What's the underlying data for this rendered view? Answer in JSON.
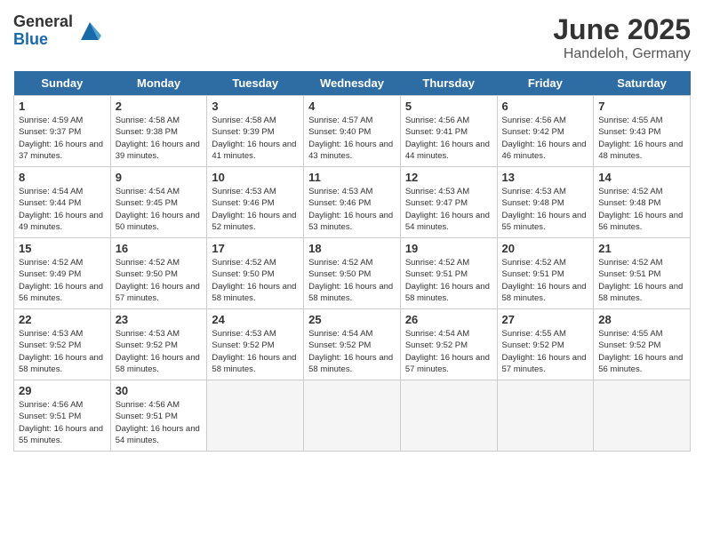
{
  "header": {
    "logo_general": "General",
    "logo_blue": "Blue",
    "title": "June 2025",
    "subtitle": "Handeloh, Germany"
  },
  "weekdays": [
    "Sunday",
    "Monday",
    "Tuesday",
    "Wednesday",
    "Thursday",
    "Friday",
    "Saturday"
  ],
  "weeks": [
    [
      {
        "day": "1",
        "sunrise": "4:59 AM",
        "sunset": "9:37 PM",
        "daylight": "16 hours and 37 minutes."
      },
      {
        "day": "2",
        "sunrise": "4:58 AM",
        "sunset": "9:38 PM",
        "daylight": "16 hours and 39 minutes."
      },
      {
        "day": "3",
        "sunrise": "4:58 AM",
        "sunset": "9:39 PM",
        "daylight": "16 hours and 41 minutes."
      },
      {
        "day": "4",
        "sunrise": "4:57 AM",
        "sunset": "9:40 PM",
        "daylight": "16 hours and 43 minutes."
      },
      {
        "day": "5",
        "sunrise": "4:56 AM",
        "sunset": "9:41 PM",
        "daylight": "16 hours and 44 minutes."
      },
      {
        "day": "6",
        "sunrise": "4:56 AM",
        "sunset": "9:42 PM",
        "daylight": "16 hours and 46 minutes."
      },
      {
        "day": "7",
        "sunrise": "4:55 AM",
        "sunset": "9:43 PM",
        "daylight": "16 hours and 48 minutes."
      }
    ],
    [
      {
        "day": "8",
        "sunrise": "4:54 AM",
        "sunset": "9:44 PM",
        "daylight": "16 hours and 49 minutes."
      },
      {
        "day": "9",
        "sunrise": "4:54 AM",
        "sunset": "9:45 PM",
        "daylight": "16 hours and 50 minutes."
      },
      {
        "day": "10",
        "sunrise": "4:53 AM",
        "sunset": "9:46 PM",
        "daylight": "16 hours and 52 minutes."
      },
      {
        "day": "11",
        "sunrise": "4:53 AM",
        "sunset": "9:46 PM",
        "daylight": "16 hours and 53 minutes."
      },
      {
        "day": "12",
        "sunrise": "4:53 AM",
        "sunset": "9:47 PM",
        "daylight": "16 hours and 54 minutes."
      },
      {
        "day": "13",
        "sunrise": "4:53 AM",
        "sunset": "9:48 PM",
        "daylight": "16 hours and 55 minutes."
      },
      {
        "day": "14",
        "sunrise": "4:52 AM",
        "sunset": "9:48 PM",
        "daylight": "16 hours and 56 minutes."
      }
    ],
    [
      {
        "day": "15",
        "sunrise": "4:52 AM",
        "sunset": "9:49 PM",
        "daylight": "16 hours and 56 minutes."
      },
      {
        "day": "16",
        "sunrise": "4:52 AM",
        "sunset": "9:50 PM",
        "daylight": "16 hours and 57 minutes."
      },
      {
        "day": "17",
        "sunrise": "4:52 AM",
        "sunset": "9:50 PM",
        "daylight": "16 hours and 58 minutes."
      },
      {
        "day": "18",
        "sunrise": "4:52 AM",
        "sunset": "9:50 PM",
        "daylight": "16 hours and 58 minutes."
      },
      {
        "day": "19",
        "sunrise": "4:52 AM",
        "sunset": "9:51 PM",
        "daylight": "16 hours and 58 minutes."
      },
      {
        "day": "20",
        "sunrise": "4:52 AM",
        "sunset": "9:51 PM",
        "daylight": "16 hours and 58 minutes."
      },
      {
        "day": "21",
        "sunrise": "4:52 AM",
        "sunset": "9:51 PM",
        "daylight": "16 hours and 58 minutes."
      }
    ],
    [
      {
        "day": "22",
        "sunrise": "4:53 AM",
        "sunset": "9:52 PM",
        "daylight": "16 hours and 58 minutes."
      },
      {
        "day": "23",
        "sunrise": "4:53 AM",
        "sunset": "9:52 PM",
        "daylight": "16 hours and 58 minutes."
      },
      {
        "day": "24",
        "sunrise": "4:53 AM",
        "sunset": "9:52 PM",
        "daylight": "16 hours and 58 minutes."
      },
      {
        "day": "25",
        "sunrise": "4:54 AM",
        "sunset": "9:52 PM",
        "daylight": "16 hours and 58 minutes."
      },
      {
        "day": "26",
        "sunrise": "4:54 AM",
        "sunset": "9:52 PM",
        "daylight": "16 hours and 57 minutes."
      },
      {
        "day": "27",
        "sunrise": "4:55 AM",
        "sunset": "9:52 PM",
        "daylight": "16 hours and 57 minutes."
      },
      {
        "day": "28",
        "sunrise": "4:55 AM",
        "sunset": "9:52 PM",
        "daylight": "16 hours and 56 minutes."
      }
    ],
    [
      {
        "day": "29",
        "sunrise": "4:56 AM",
        "sunset": "9:51 PM",
        "daylight": "16 hours and 55 minutes."
      },
      {
        "day": "30",
        "sunrise": "4:56 AM",
        "sunset": "9:51 PM",
        "daylight": "16 hours and 54 minutes."
      },
      null,
      null,
      null,
      null,
      null
    ]
  ]
}
